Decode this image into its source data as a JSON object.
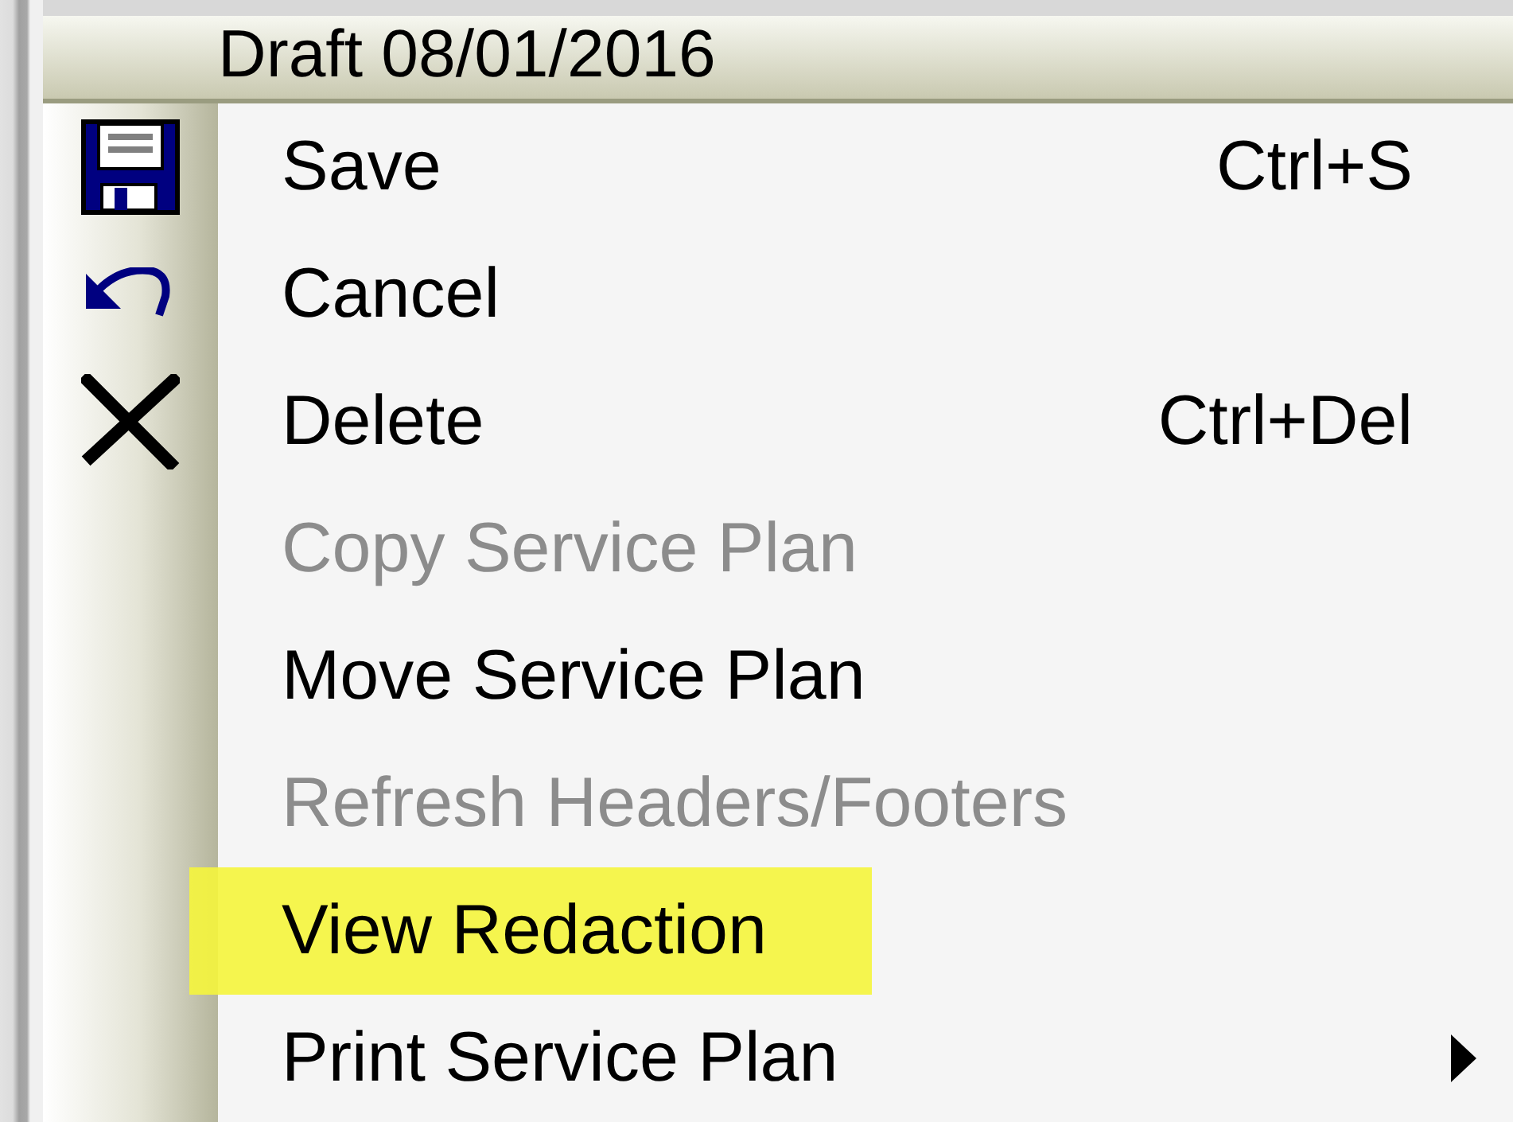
{
  "menu": {
    "title": "Draft 08/01/2016",
    "items": [
      {
        "label": "Save",
        "shortcut": "Ctrl+S",
        "disabled": false,
        "selected": false,
        "submenu": false
      },
      {
        "label": "Cancel",
        "disabled": false,
        "selected": false,
        "submenu": false
      },
      {
        "label": "Delete",
        "shortcut": "Ctrl+Del",
        "disabled": false,
        "selected": false,
        "submenu": false
      },
      {
        "label": "Copy Service Plan",
        "disabled": true,
        "selected": false,
        "submenu": false
      },
      {
        "label": "Move Service Plan",
        "disabled": false,
        "selected": false,
        "submenu": false
      },
      {
        "label": "Refresh Headers/Footers",
        "disabled": true,
        "selected": false,
        "submenu": false
      },
      {
        "label": "View Redaction",
        "disabled": false,
        "selected": true,
        "submenu": false
      },
      {
        "label": "Print Service Plan",
        "disabled": false,
        "selected": false,
        "submenu": true
      }
    ]
  }
}
